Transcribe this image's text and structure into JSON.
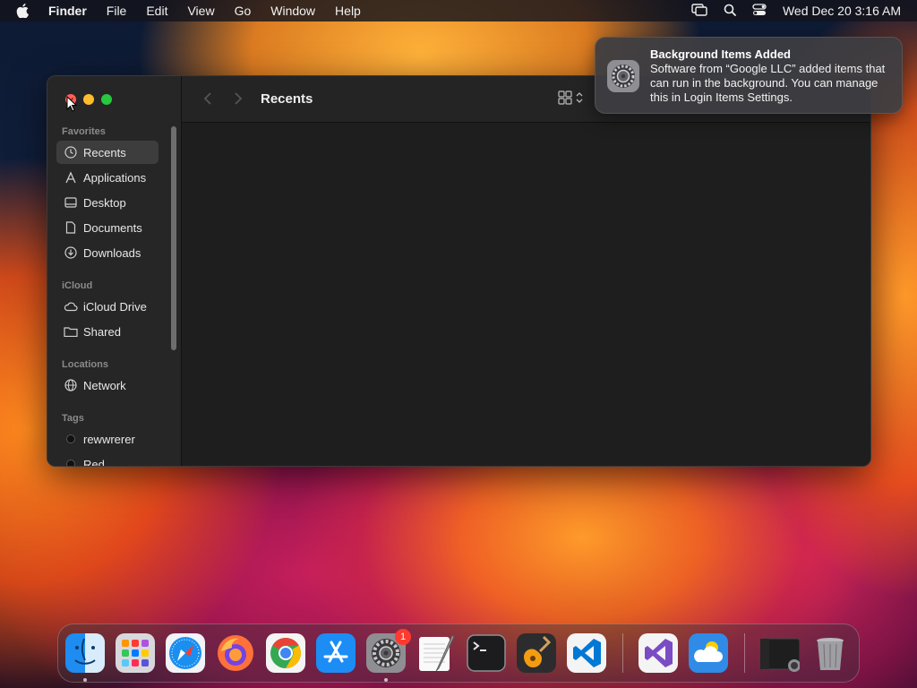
{
  "menubar": {
    "app_name": "Finder",
    "menus": [
      "File",
      "Edit",
      "View",
      "Go",
      "Window",
      "Help"
    ],
    "clock": "Wed Dec 20  3:16 AM"
  },
  "finder": {
    "title": "Recents",
    "sidebar": {
      "favorites_label": "Favorites",
      "favorites": [
        {
          "label": "Recents",
          "icon": "clock-icon",
          "selected": true
        },
        {
          "label": "Applications",
          "icon": "applications-icon"
        },
        {
          "label": "Desktop",
          "icon": "desktop-icon"
        },
        {
          "label": "Documents",
          "icon": "document-icon"
        },
        {
          "label": "Downloads",
          "icon": "download-icon"
        }
      ],
      "icloud_label": "iCloud",
      "icloud": [
        {
          "label": "iCloud Drive",
          "icon": "cloud-icon"
        },
        {
          "label": "Shared",
          "icon": "shared-folder-icon"
        }
      ],
      "locations_label": "Locations",
      "locations": [
        {
          "label": "Network",
          "icon": "globe-icon"
        }
      ],
      "tags_label": "Tags",
      "tags": [
        {
          "label": "rewwrerer",
          "icon": "tag-dot-icon"
        },
        {
          "label": "Red",
          "icon": "tag-dot-icon"
        }
      ]
    }
  },
  "notification": {
    "title": "Background Items Added",
    "body": "Software from “Google LLC” added items that can run in the background. You can manage this in Login Items Settings.",
    "icon": "system-settings-icon"
  },
  "dock": {
    "items": [
      {
        "name": "Finder",
        "icon": "finder-icon",
        "running": true
      },
      {
        "name": "Launchpad",
        "icon": "launchpad-icon"
      },
      {
        "name": "Safari",
        "icon": "safari-icon"
      },
      {
        "name": "Firefox",
        "icon": "firefox-icon"
      },
      {
        "name": "Google Chrome",
        "icon": "chrome-icon"
      },
      {
        "name": "App Store",
        "icon": "app-store-icon"
      },
      {
        "name": "System Settings",
        "icon": "system-settings-icon",
        "running": true,
        "badge": "1"
      },
      {
        "name": "TextEdit",
        "icon": "textedit-icon"
      },
      {
        "name": "Terminal",
        "icon": "terminal-icon"
      },
      {
        "name": "GarageBand",
        "icon": "garageband-icon"
      },
      {
        "name": "Visual Studio Code",
        "icon": "vscode-icon"
      },
      {
        "name": "Visual Studio",
        "icon": "visual-studio-icon"
      },
      {
        "name": "Weather",
        "icon": "weather-icon"
      },
      {
        "name": "Recent window",
        "icon": "window-thumbnail-icon"
      },
      {
        "name": "Trash",
        "icon": "trash-icon"
      }
    ]
  }
}
